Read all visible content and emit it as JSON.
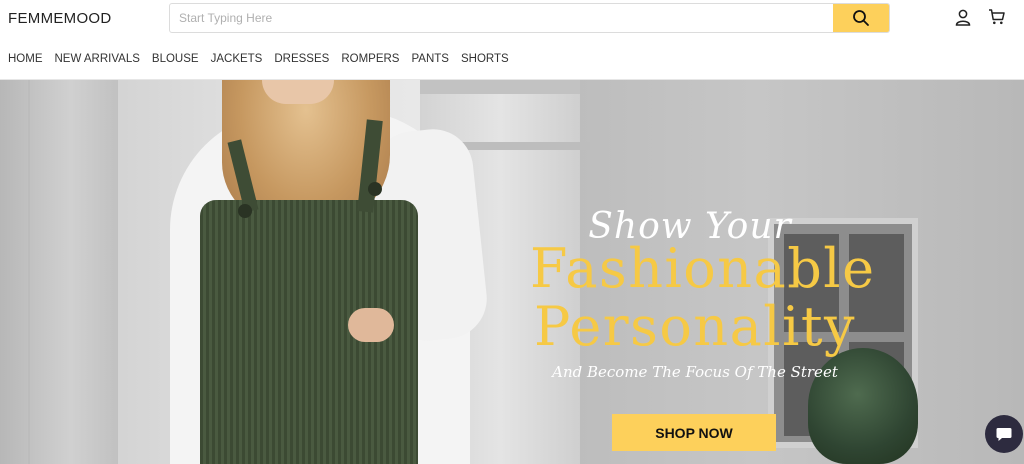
{
  "header": {
    "logo": "FEMMEMOOD",
    "search": {
      "placeholder": "Start Typing Here",
      "value": ""
    },
    "icons": {
      "search": "search-icon",
      "account": "user-icon",
      "cart": "cart-icon"
    }
  },
  "nav": {
    "items": [
      {
        "label": "HOME"
      },
      {
        "label": "NEW ARRIVALS"
      },
      {
        "label": "BLOUSE"
      },
      {
        "label": "JACKETS"
      },
      {
        "label": "DRESSES"
      },
      {
        "label": "ROMPERS"
      },
      {
        "label": "PANTS"
      },
      {
        "label": "SHORTS"
      }
    ]
  },
  "hero": {
    "script_line": "Show Your",
    "headline_1": "Fashionable",
    "headline_2": "Personality",
    "subline": "And Become The Focus Of The Street",
    "cta": "SHOP NOW"
  },
  "chat": {
    "icon": "chat-icon"
  },
  "colors": {
    "accent": "#fdd05b",
    "headline": "#f6c945",
    "chat": "#2d2b3f"
  }
}
